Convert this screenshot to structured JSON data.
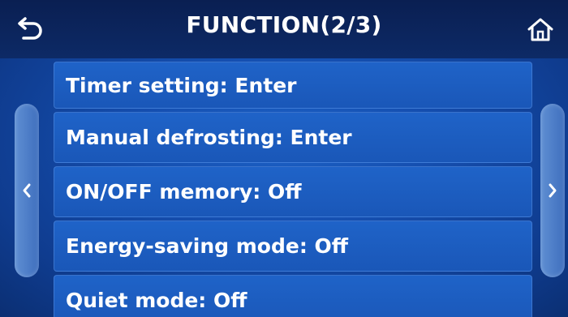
{
  "header": {
    "title": "FUNCTION(2/3)",
    "back_icon": "back-arrow-icon",
    "home_icon": "home-icon"
  },
  "menu": {
    "items": [
      {
        "label": "Timer setting: Enter"
      },
      {
        "label": "Manual defrosting: Enter"
      },
      {
        "label": "ON/OFF memory: Off"
      },
      {
        "label": "Energy-saving mode: Off"
      },
      {
        "label": "Quiet mode: Off"
      }
    ]
  },
  "nav": {
    "prev_icon": "chevron-left-icon",
    "next_icon": "chevron-right-icon"
  },
  "colors": {
    "background": "#1556b8",
    "header": "#0b2258",
    "item": "#1d5ec2",
    "text": "#ffffff"
  }
}
